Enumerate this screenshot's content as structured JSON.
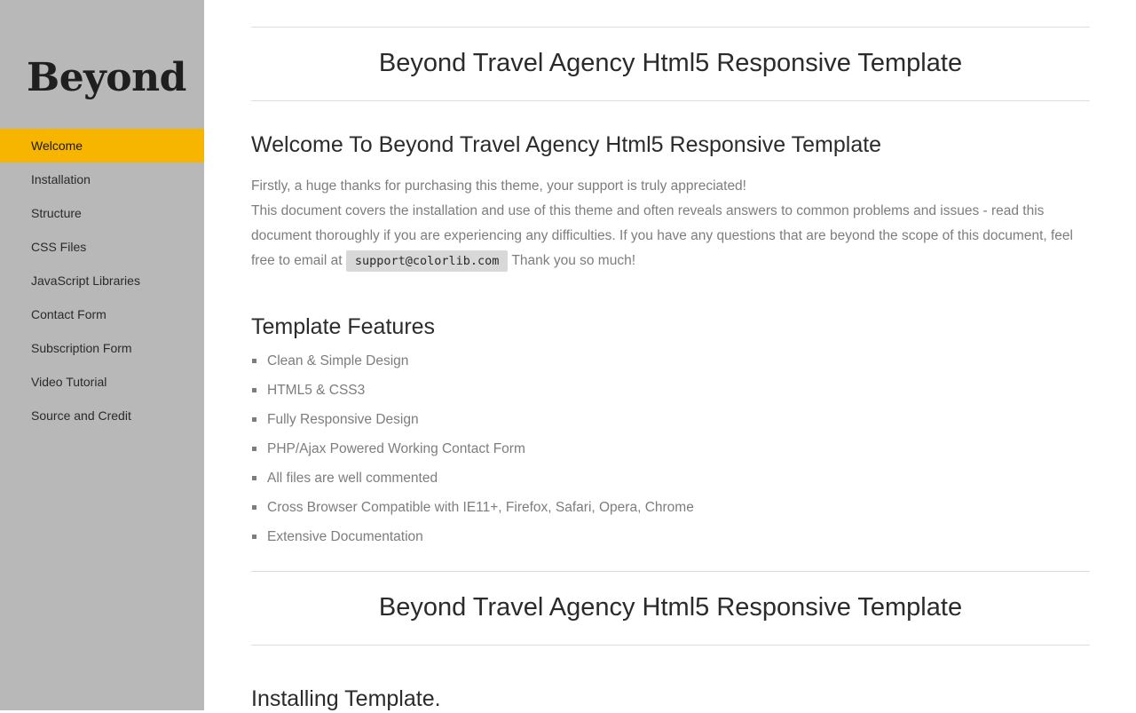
{
  "sidebar": {
    "logo": "Beyond",
    "nav": [
      {
        "label": "Welcome",
        "active": true
      },
      {
        "label": "Installation"
      },
      {
        "label": "Structure"
      },
      {
        "label": "CSS Files"
      },
      {
        "label": "JavaScript Libraries"
      },
      {
        "label": "Contact Form"
      },
      {
        "label": "Subscription Form"
      },
      {
        "label": "Video Tutorial"
      },
      {
        "label": "Source and Credit"
      }
    ],
    "active_color": "#f8b500"
  },
  "main": {
    "banner_title": "Beyond Travel Agency Html5 Responsive Template",
    "welcome": {
      "title": "Welcome To Beyond Travel Agency Html5 Responsive Template",
      "line1": "Firstly, a huge thanks for purchasing this theme, your support is truly appreciated!",
      "line2": "This document covers the installation and use of this theme and often reveals answers to common problems and issues - read this document thoroughly if you are experiencing any difficulties. If you have any questions that are beyond the scope of this document, feel free to email at",
      "email": "support@colorlib.com",
      "line2_end": "Thank you so much!"
    },
    "features": {
      "title": "Template Features",
      "items": [
        "Clean & Simple Design",
        "HTML5 & CSS3",
        "Fully Responsive Design",
        "PHP/Ajax Powered Working Contact Form",
        "All files are well commented",
        "Cross Browser Compatible with IE11+, Firefox, Safari, Opera, Chrome",
        "Extensive Documentation"
      ]
    },
    "banner_title_2": "Beyond Travel Agency Html5 Responsive Template",
    "install_title": "Installing Template."
  }
}
